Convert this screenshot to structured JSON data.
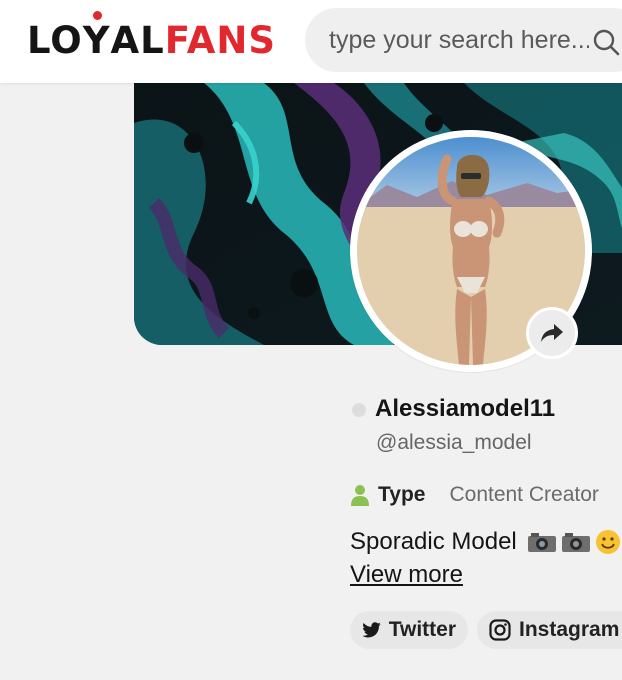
{
  "header": {
    "logo_part1": "LO",
    "logo_y": "Y",
    "logo_part2": "AL",
    "logo_part3": "FANS",
    "search_placeholder": "type your search here..."
  },
  "colors": {
    "brand_red": "#e1282e",
    "brand_dark": "#151515",
    "accent_green": "#8cc152"
  },
  "icons": {
    "search": "search-icon",
    "share": "share-icon",
    "type": "person-icon",
    "twitter": "twitter-icon",
    "instagram": "instagram-icon"
  },
  "profile": {
    "display_name": "Alessiamodel11",
    "handle": "@alessia_model",
    "type_label": "Type",
    "type_value": "Content Creator",
    "bio": "Sporadic Model",
    "view_more": "View more"
  },
  "socials": [
    {
      "label": "Twitter"
    },
    {
      "label": "Instagram"
    }
  ]
}
